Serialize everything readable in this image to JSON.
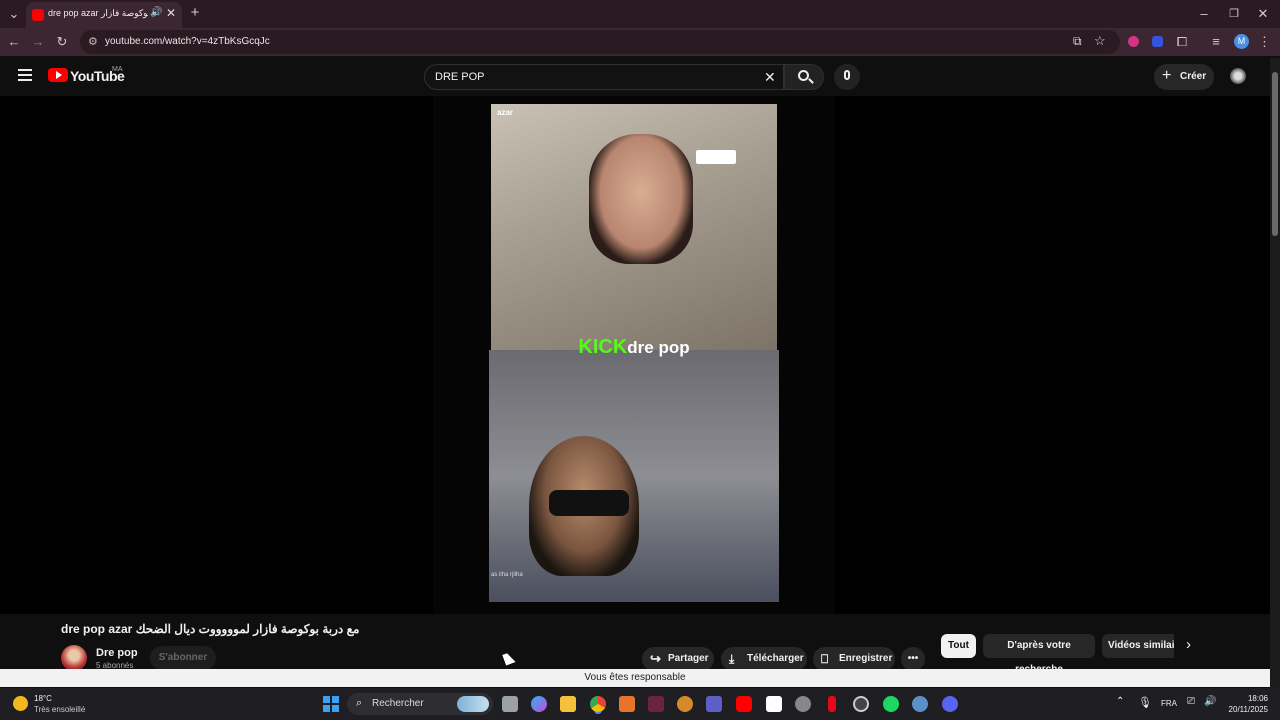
{
  "browser": {
    "tab_title": "dre pop azar مع دربة بوكوصة فازار...",
    "url": "youtube.com/watch?v=4zTbKsGcqJc",
    "profile_initial": "M"
  },
  "youtube": {
    "logo_text": "YouTube",
    "country_code": "MA",
    "search_value": "DRE POP",
    "create_label": "Créer"
  },
  "video": {
    "overlay_watermark": "azar",
    "overlay_kick": "KICK",
    "overlay_name": "dre pop",
    "subtitle_snippet": "as liha rjliha",
    "title": "dre pop azar مع دربة بوكوصة فازار لموووووت ديال الضحك",
    "channel_name": "Dre pop",
    "subscribers": "5 abonnés",
    "subscribe_label": "S'abonner",
    "actions": {
      "share": "Partager",
      "download": "Télécharger",
      "save": "Enregistrer"
    }
  },
  "chips": [
    "Tout",
    "D'après votre recherche",
    "Vidéos similaire"
  ],
  "infobar_text": "Vous êtes responsable",
  "taskbar": {
    "weather_temp": "18°C",
    "weather_desc": "Très ensoleillé",
    "search_placeholder": "Rechercher",
    "lang": "FRA",
    "time": "18:06",
    "date": "20/11/2025"
  }
}
